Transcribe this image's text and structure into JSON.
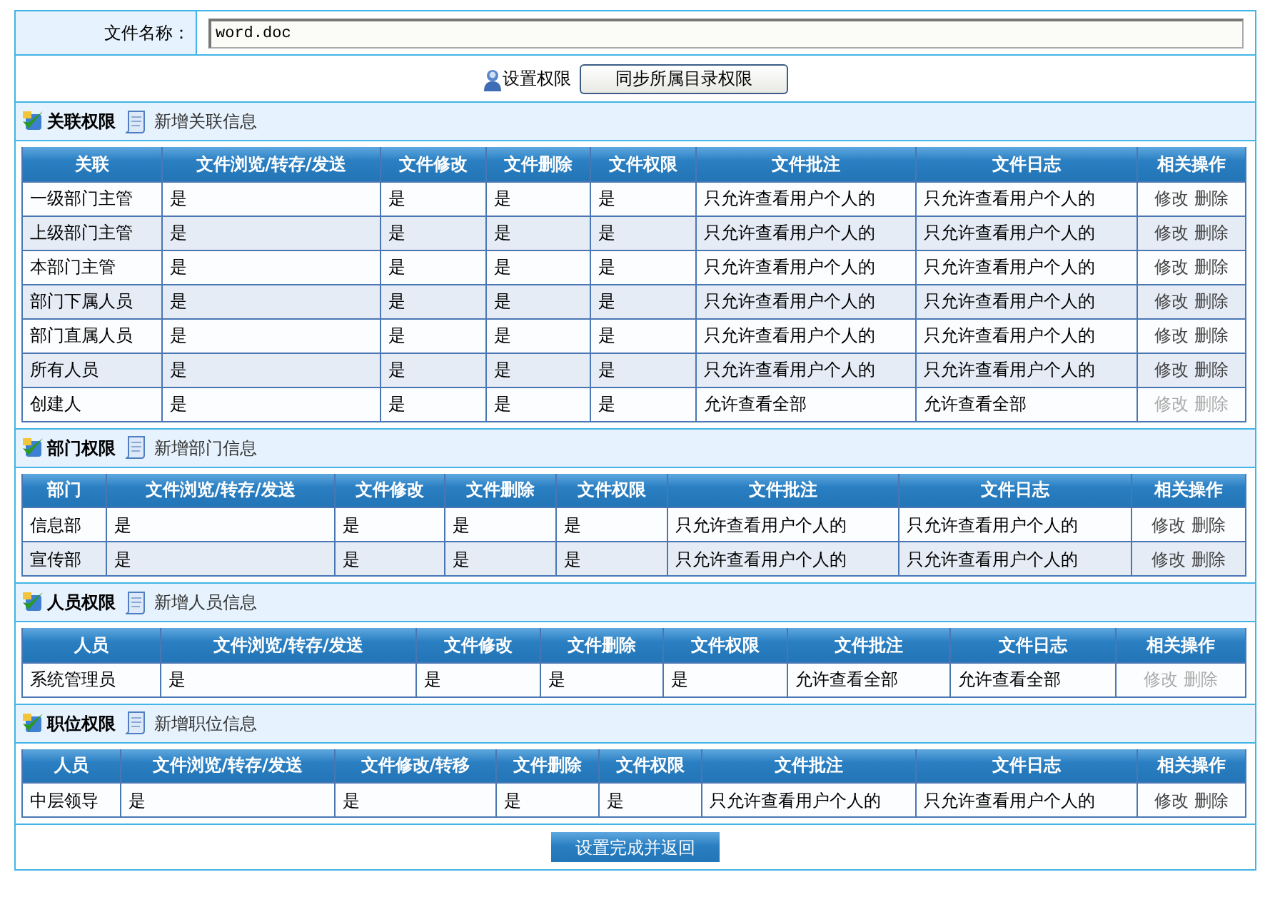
{
  "file_name": {
    "label": "文件名称：",
    "value": "word.doc"
  },
  "toolbar": {
    "label": "设置权限",
    "sync_button": "同步所属目录权限"
  },
  "sections": [
    {
      "title": "关联权限",
      "add_link": "新增关联信息",
      "columns": [
        "关联",
        "文件浏览/转存/发送",
        "文件修改",
        "文件删除",
        "文件权限",
        "文件批注",
        "文件日志",
        "相关操作"
      ],
      "rows": [
        {
          "cells": [
            "一级部门主管",
            "是",
            "是",
            "是",
            "是",
            "只允许查看用户个人的",
            "只允许查看用户个人的"
          ],
          "actions": [
            "修改",
            "删除"
          ],
          "disabled": false
        },
        {
          "cells": [
            "上级部门主管",
            "是",
            "是",
            "是",
            "是",
            "只允许查看用户个人的",
            "只允许查看用户个人的"
          ],
          "actions": [
            "修改",
            "删除"
          ],
          "disabled": false
        },
        {
          "cells": [
            "本部门主管",
            "是",
            "是",
            "是",
            "是",
            "只允许查看用户个人的",
            "只允许查看用户个人的"
          ],
          "actions": [
            "修改",
            "删除"
          ],
          "disabled": false
        },
        {
          "cells": [
            "部门下属人员",
            "是",
            "是",
            "是",
            "是",
            "只允许查看用户个人的",
            "只允许查看用户个人的"
          ],
          "actions": [
            "修改",
            "删除"
          ],
          "disabled": false
        },
        {
          "cells": [
            "部门直属人员",
            "是",
            "是",
            "是",
            "是",
            "只允许查看用户个人的",
            "只允许查看用户个人的"
          ],
          "actions": [
            "修改",
            "删除"
          ],
          "disabled": false
        },
        {
          "cells": [
            "所有人员",
            "是",
            "是",
            "是",
            "是",
            "只允许查看用户个人的",
            "只允许查看用户个人的"
          ],
          "actions": [
            "修改",
            "删除"
          ],
          "disabled": false
        },
        {
          "cells": [
            "创建人",
            "是",
            "是",
            "是",
            "是",
            "允许查看全部",
            "允许查看全部"
          ],
          "actions": [
            "修改",
            "删除"
          ],
          "disabled": true
        }
      ]
    },
    {
      "title": "部门权限",
      "add_link": "新增部门信息",
      "columns": [
        "部门",
        "文件浏览/转存/发送",
        "文件修改",
        "文件删除",
        "文件权限",
        "文件批注",
        "文件日志",
        "相关操作"
      ],
      "rows": [
        {
          "cells": [
            "信息部",
            "是",
            "是",
            "是",
            "是",
            "只允许查看用户个人的",
            "只允许查看用户个人的"
          ],
          "actions": [
            "修改",
            "删除"
          ],
          "disabled": false
        },
        {
          "cells": [
            "宣传部",
            "是",
            "是",
            "是",
            "是",
            "只允许查看用户个人的",
            "只允许查看用户个人的"
          ],
          "actions": [
            "修改",
            "删除"
          ],
          "disabled": false
        }
      ]
    },
    {
      "title": "人员权限",
      "add_link": "新增人员信息",
      "columns": [
        "人员",
        "文件浏览/转存/发送",
        "文件修改",
        "文件删除",
        "文件权限",
        "文件批注",
        "文件日志",
        "相关操作"
      ],
      "rows": [
        {
          "cells": [
            "系统管理员",
            "是",
            "是",
            "是",
            "是",
            "允许查看全部",
            "允许查看全部"
          ],
          "actions": [
            "修改",
            "删除"
          ],
          "disabled": true
        }
      ]
    },
    {
      "title": "职位权限",
      "add_link": "新增职位信息",
      "columns": [
        "人员",
        "文件浏览/转存/发送",
        "文件修改/转移",
        "文件删除",
        "文件权限",
        "文件批注",
        "文件日志",
        "相关操作"
      ],
      "rows": [
        {
          "cells": [
            "中层领导",
            "是",
            "是",
            "是",
            "是",
            "只允许查看用户个人的",
            "只允许查看用户个人的"
          ],
          "actions": [
            "修改",
            "删除"
          ],
          "disabled": false
        }
      ]
    }
  ],
  "submit_button": "设置完成并返回"
}
